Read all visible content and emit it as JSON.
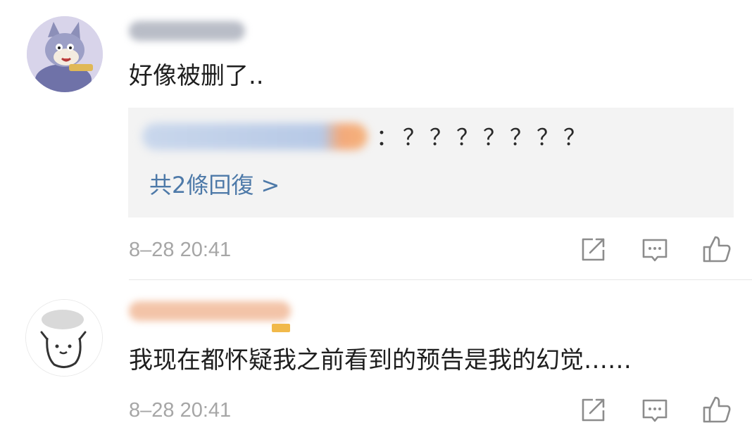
{
  "comments": [
    {
      "content": "好像被删了..",
      "reply_preview": {
        "text": "：？？？？？？？",
        "more_label": "共2條回復 >"
      },
      "timestamp": "8–28 20:41",
      "actions": [
        "share-icon",
        "comment-icon",
        "like-icon"
      ]
    },
    {
      "content": "我现在都怀疑我之前看到的预告是我的幻觉……",
      "timestamp": "8–28 20:41",
      "actions": [
        "share-icon",
        "comment-icon",
        "like-icon"
      ]
    }
  ],
  "colors": {
    "link": "#4d79a8",
    "meta": "#a6a6a6",
    "reply_bg": "#f3f3f3",
    "icon": "#8c8c8c"
  }
}
